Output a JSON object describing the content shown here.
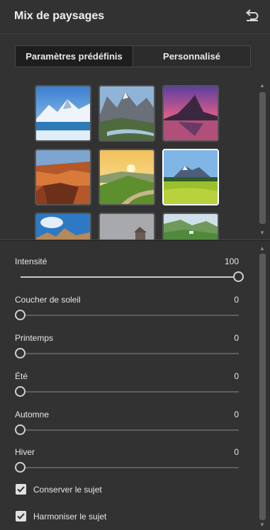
{
  "panel": {
    "title": "Mix de paysages",
    "reset_icon": "undo-icon"
  },
  "tabs": [
    {
      "label": "Paramètres prédéfinis",
      "active": true
    },
    {
      "label": "Personnalisé",
      "active": false
    }
  ],
  "presets": [
    {
      "name": "winter-lake",
      "selected": false
    },
    {
      "name": "mountain-valley",
      "selected": false
    },
    {
      "name": "sunset-peak",
      "selected": false
    },
    {
      "name": "canyon",
      "selected": false
    },
    {
      "name": "sunrise-hills",
      "selected": false
    },
    {
      "name": "spring-meadow",
      "selected": true
    },
    {
      "name": "rock-sky",
      "selected": false
    },
    {
      "name": "misty-house",
      "selected": false
    },
    {
      "name": "green-valley",
      "selected": false
    }
  ],
  "sliders": [
    {
      "label": "Intensité",
      "value": "100",
      "fraction": 1.0
    },
    {
      "label": "Coucher de soleil",
      "value": "0",
      "fraction": 0
    },
    {
      "label": "Printemps",
      "value": "0",
      "fraction": 0
    },
    {
      "label": "Été",
      "value": "0",
      "fraction": 0
    },
    {
      "label": "Automne",
      "value": "0",
      "fraction": 0
    },
    {
      "label": "Hiver",
      "value": "0",
      "fraction": 0
    }
  ],
  "checkboxes": [
    {
      "label": "Conserver le sujet",
      "checked": true
    },
    {
      "label": "Harmoniser le sujet",
      "checked": true
    }
  ],
  "colors": {
    "panel_bg": "#323232",
    "accent": "#e1e1e1"
  }
}
